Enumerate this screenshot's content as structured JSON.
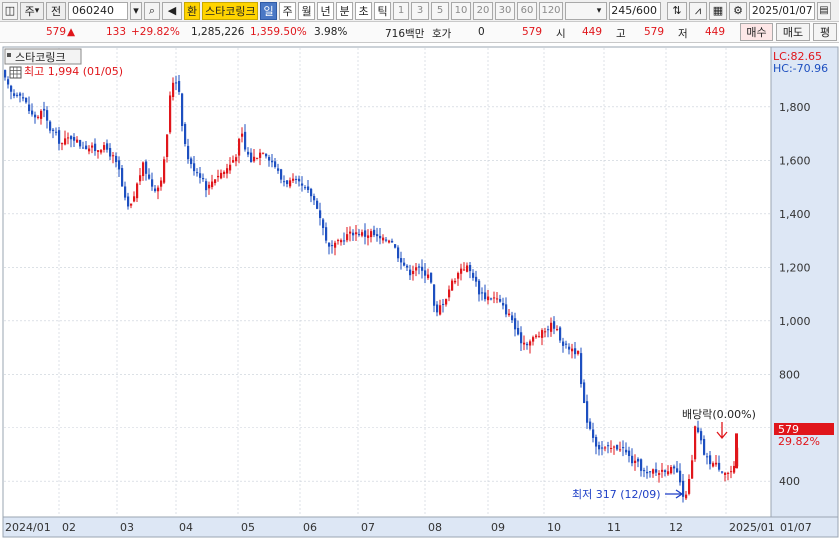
{
  "toolbar": {
    "market": "주",
    "all_label": "전",
    "code": "060240",
    "exchange_button": "환",
    "stock_name": "스타코링크",
    "periods": [
      "일",
      "주",
      "월",
      "년",
      "분",
      "초",
      "틱"
    ],
    "active_period": "일",
    "intervals": [
      "1",
      "3",
      "5",
      "10",
      "20",
      "30",
      "60",
      "120"
    ],
    "count": "245/600",
    "date": "2025/01/07"
  },
  "quote": {
    "price": "579",
    "change": "133",
    "change_pct": "+29.82%",
    "volume": "1,285,226",
    "volume_ratio": "1,359.50%",
    "turnover": "3.98%",
    "amount": "716백만",
    "bid_label": "호가",
    "bid_value": "0",
    "ask_price": "579",
    "open_label": "시",
    "open": "449",
    "high_label": "고",
    "high": "579",
    "low_label": "저",
    "low": "449",
    "buy_button": "매수",
    "sell_button": "매도",
    "eval_button": "평"
  },
  "chart_data": {
    "type": "candlestick",
    "title": "스타코링크",
    "legend_right": [
      "LC:82.65",
      "HC:-70.96"
    ],
    "annotations": {
      "high": "최고 1,994 (01/05)",
      "low": "최저 317 (12/09)",
      "dividend": "배당락(0.00%)"
    },
    "last_price_label": "579",
    "last_change_label": "29.82%",
    "y_ticks": [
      "1,800",
      "1,600",
      "1,400",
      "1,200",
      "1,000",
      "800",
      "600",
      "400"
    ],
    "y_tick_values": [
      1800,
      1600,
      1400,
      1200,
      1000,
      800,
      600,
      400
    ],
    "ylim": [
      270,
      2020
    ],
    "x_labels": [
      "2024/01",
      "02",
      "03",
      "04",
      "05",
      "06",
      "07",
      "08",
      "09",
      "10",
      "11",
      "12",
      "2025/01",
      "01/07"
    ],
    "colors": {
      "up": "#e0161b",
      "down": "#1d4fc0",
      "axis_bg": "#dde7f5",
      "grid": "#c8cfd8"
    },
    "close_path": [
      [
        1,
        1930
      ],
      [
        6,
        1880
      ],
      [
        12,
        1840
      ],
      [
        18,
        1860
      ],
      [
        24,
        1820
      ],
      [
        30,
        1770
      ],
      [
        36,
        1760
      ],
      [
        42,
        1790
      ],
      [
        48,
        1720
      ],
      [
        54,
        1700
      ],
      [
        60,
        1660
      ],
      [
        66,
        1680
      ],
      [
        72,
        1690
      ],
      [
        78,
        1660
      ],
      [
        86,
        1650
      ],
      [
        94,
        1640
      ],
      [
        100,
        1650
      ],
      [
        106,
        1640
      ],
      [
        112,
        1610
      ],
      [
        118,
        1560
      ],
      [
        122,
        1480
      ],
      [
        126,
        1420
      ],
      [
        130,
        1430
      ],
      [
        134,
        1480
      ],
      [
        138,
        1540
      ],
      [
        142,
        1580
      ],
      [
        146,
        1550
      ],
      [
        150,
        1510
      ],
      [
        156,
        1490
      ],
      [
        162,
        1560
      ],
      [
        166,
        1700
      ],
      [
        170,
        1880
      ],
      [
        174,
        1910
      ],
      [
        178,
        1860
      ],
      [
        182,
        1700
      ],
      [
        186,
        1620
      ],
      [
        190,
        1580
      ],
      [
        196,
        1560
      ],
      [
        202,
        1530
      ],
      [
        206,
        1490
      ],
      [
        212,
        1530
      ],
      [
        218,
        1550
      ],
      [
        224,
        1560
      ],
      [
        230,
        1590
      ],
      [
        236,
        1630
      ],
      [
        240,
        1710
      ],
      [
        244,
        1640
      ],
      [
        250,
        1600
      ],
      [
        256,
        1620
      ],
      [
        262,
        1640
      ],
      [
        268,
        1610
      ],
      [
        274,
        1580
      ],
      [
        280,
        1530
      ],
      [
        286,
        1520
      ],
      [
        292,
        1520
      ],
      [
        298,
        1510
      ],
      [
        304,
        1490
      ],
      [
        310,
        1470
      ],
      [
        316,
        1430
      ],
      [
        320,
        1370
      ],
      [
        324,
        1320
      ],
      [
        328,
        1270
      ],
      [
        334,
        1280
      ],
      [
        340,
        1300
      ],
      [
        346,
        1320
      ],
      [
        352,
        1330
      ],
      [
        358,
        1330
      ],
      [
        364,
        1320
      ],
      [
        370,
        1330
      ],
      [
        376,
        1310
      ],
      [
        382,
        1300
      ],
      [
        390,
        1310
      ],
      [
        396,
        1250
      ],
      [
        400,
        1230
      ],
      [
        406,
        1190
      ],
      [
        410,
        1180
      ],
      [
        414,
        1210
      ],
      [
        418,
        1190
      ],
      [
        422,
        1180
      ],
      [
        428,
        1180
      ],
      [
        432,
        1100
      ],
      [
        434,
        1000
      ],
      [
        438,
        1050
      ],
      [
        444,
        1080
      ],
      [
        450,
        1140
      ],
      [
        456,
        1170
      ],
      [
        460,
        1200
      ],
      [
        466,
        1200
      ],
      [
        472,
        1170
      ],
      [
        478,
        1110
      ],
      [
        484,
        1090
      ],
      [
        490,
        1090
      ],
      [
        496,
        1080
      ],
      [
        502,
        1050
      ],
      [
        508,
        1020
      ],
      [
        512,
        1000
      ],
      [
        516,
        940
      ],
      [
        522,
        920
      ],
      [
        528,
        920
      ],
      [
        534,
        940
      ],
      [
        540,
        950
      ],
      [
        546,
        970
      ],
      [
        552,
        990
      ],
      [
        556,
        960
      ],
      [
        560,
        930
      ],
      [
        564,
        900
      ],
      [
        570,
        900
      ],
      [
        576,
        880
      ],
      [
        578,
        870
      ],
      [
        580,
        760
      ],
      [
        582,
        700
      ],
      [
        586,
        630
      ],
      [
        590,
        590
      ],
      [
        596,
        530
      ],
      [
        602,
        520
      ],
      [
        608,
        520
      ],
      [
        614,
        525
      ],
      [
        620,
        530
      ],
      [
        626,
        500
      ],
      [
        632,
        470
      ],
      [
        638,
        460
      ],
      [
        644,
        430
      ],
      [
        648,
        420
      ],
      [
        652,
        440
      ],
      [
        656,
        430
      ],
      [
        660,
        440
      ],
      [
        666,
        450
      ],
      [
        672,
        440
      ],
      [
        678,
        420
      ],
      [
        682,
        330
      ],
      [
        686,
        370
      ],
      [
        690,
        430
      ],
      [
        694,
        600
      ],
      [
        698,
        570
      ],
      [
        704,
        490
      ],
      [
        710,
        470
      ],
      [
        716,
        460
      ],
      [
        722,
        440
      ],
      [
        728,
        430
      ],
      [
        734,
        450
      ],
      [
        738,
        579
      ]
    ]
  }
}
